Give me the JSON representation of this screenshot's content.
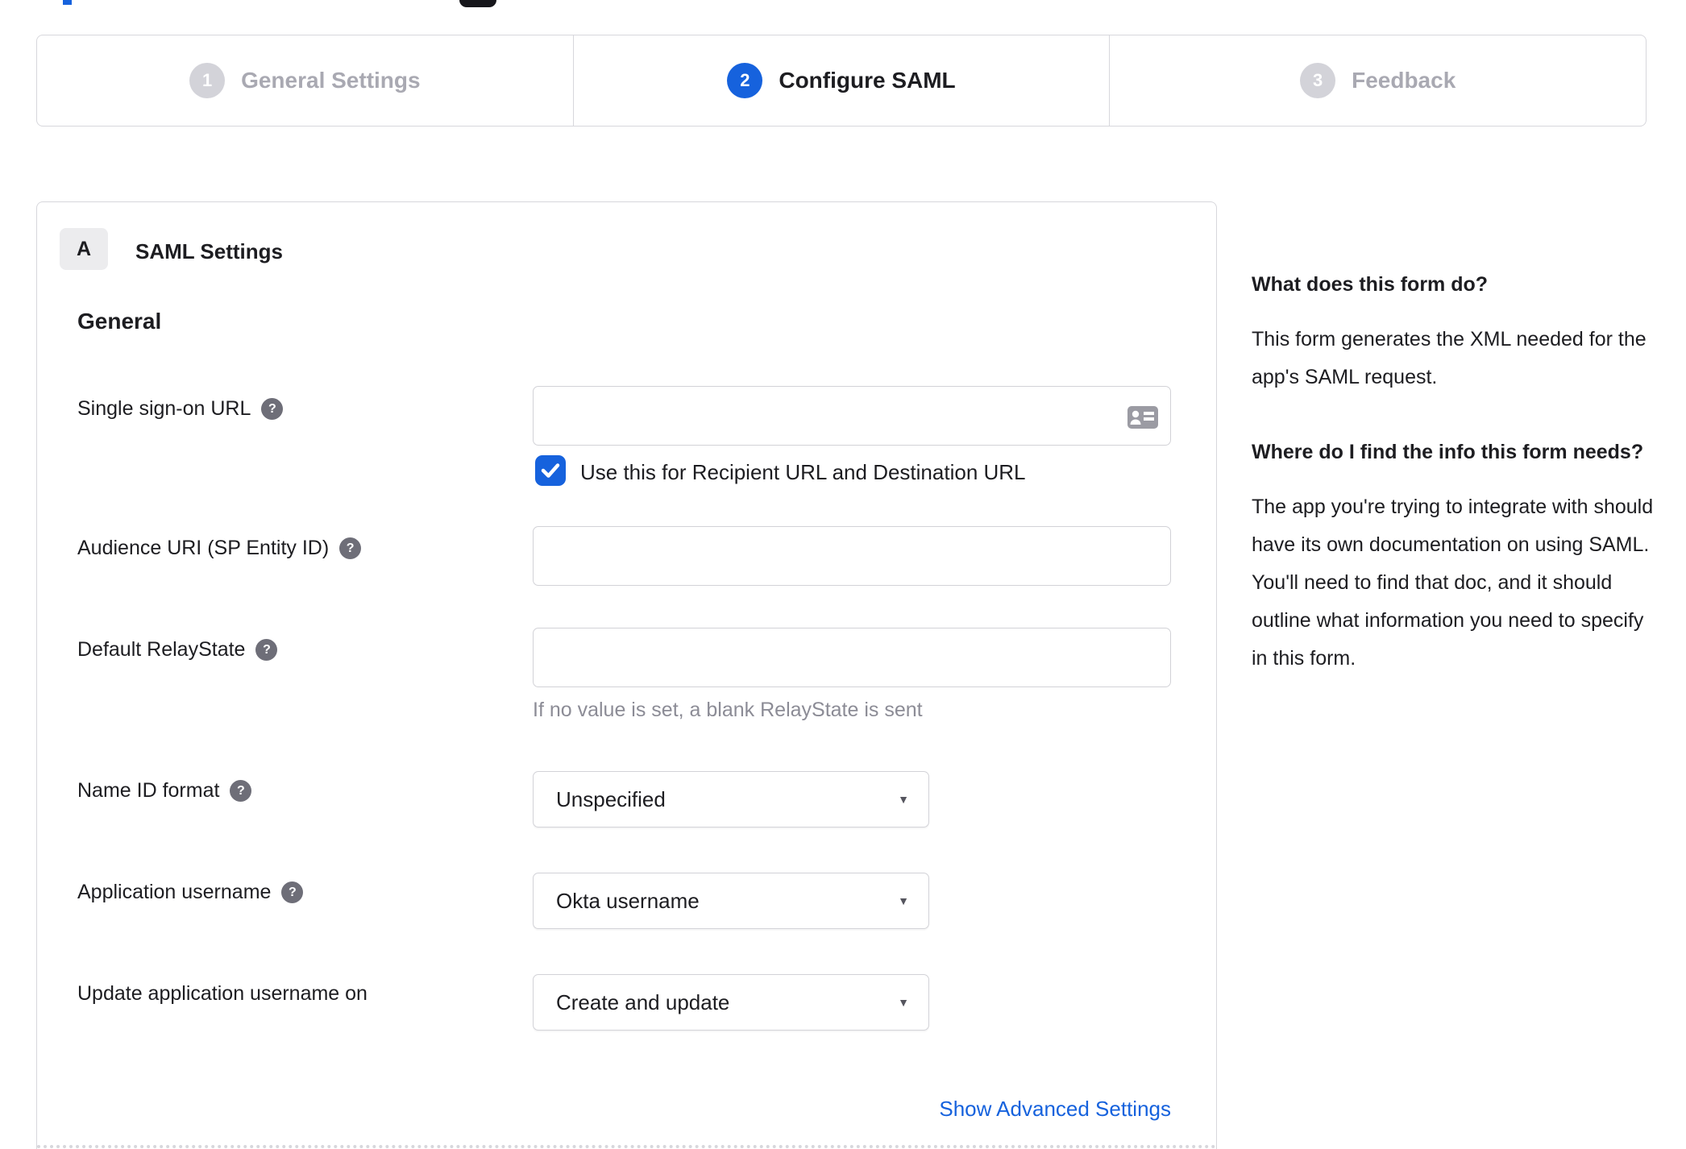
{
  "icons": {
    "help_glyph": "?",
    "caret_glyph": "▼"
  },
  "colors": {
    "accent_blue": "#1662dd",
    "border_gray": "#d7d7dc",
    "inactive_step_gray": "#d3d3d9",
    "text_dark": "#1d1d21",
    "hint_gray": "#8c8c96"
  },
  "stepper": {
    "steps": [
      {
        "number": "1",
        "label": "General Settings",
        "state": "inactive"
      },
      {
        "number": "2",
        "label": "Configure SAML",
        "state": "active"
      },
      {
        "number": "3",
        "label": "Feedback",
        "state": "inactive"
      }
    ]
  },
  "panel": {
    "badge": "A",
    "title": "SAML Settings",
    "group_title": "General",
    "sso_url": {
      "label": "Single sign-on URL",
      "value": ""
    },
    "sso_checkbox": {
      "checked": true,
      "label": "Use this for Recipient URL and Destination URL"
    },
    "audience_uri": {
      "label": "Audience URI (SP Entity ID)",
      "value": ""
    },
    "relay_state": {
      "label": "Default RelayState",
      "value": "",
      "hint": "If no value is set, a blank RelayState is sent"
    },
    "name_id_format": {
      "label": "Name ID format",
      "value": "Unspecified"
    },
    "app_username": {
      "label": "Application username",
      "value": "Okta username"
    },
    "update_username": {
      "label": "Update application username on",
      "value": "Create and update"
    },
    "advanced_link": "Show Advanced Settings"
  },
  "sidebar": {
    "q1": "What does this form do?",
    "a1": "This form generates the XML needed for the app's SAML request.",
    "q2": "Where do I find the info this form needs?",
    "a2": "The app you're trying to integrate with should have its own documentation on using SAML. You'll need to find that doc, and it should outline what information you need to specify in this form."
  }
}
